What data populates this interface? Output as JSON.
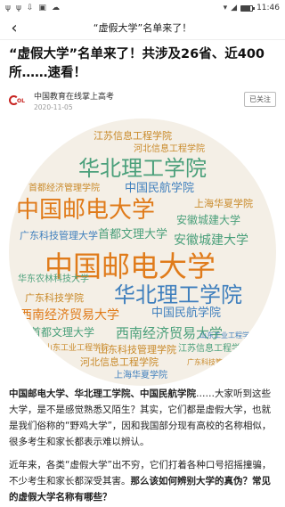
{
  "status": {
    "left_icons": [
      "cat-icon",
      "cat-icon",
      "download-icon",
      "image-icon",
      "cloud-icon"
    ],
    "left_glyphs": [
      "ψ",
      "ψ",
      "⇩",
      "▣",
      "☁"
    ],
    "time": "11:46"
  },
  "nav": {
    "title": "“虚假大学”名单来了！"
  },
  "article": {
    "headline": "“虚假大学”名单来了！共涉及26省、近400所……速看！",
    "author": "中国教育在线掌上高考",
    "date": "2020-11-05",
    "follow": "已关注",
    "logo_text": "OL"
  },
  "cloud": {
    "words": [
      {
        "t": "江苏信息工程学院",
        "c": "#c98a2a"
      },
      {
        "t": "河北信息工程学院",
        "c": "#c98a2a"
      },
      {
        "t": "华北理工学院",
        "c": "#4ba07b"
      },
      {
        "t": "首都经济管理学院",
        "c": "#c98a2a"
      },
      {
        "t": "中国民航学院",
        "c": "#3f7fbd"
      },
      {
        "t": "上海华夏学院",
        "c": "#c98a2a"
      },
      {
        "t": "中国邮电大学",
        "c": "#e07b1a"
      },
      {
        "t": "安徽城建大学",
        "c": "#4ba07b"
      },
      {
        "t": "首都文理大学",
        "c": "#4ba07b"
      },
      {
        "t": "广东科技管理大学",
        "c": "#3f7fbd"
      },
      {
        "t": "安徽城建大学",
        "c": "#4ba07b"
      },
      {
        "t": "中国邮电大学",
        "c": "#e07b1a"
      },
      {
        "t": "华东农林科技大学",
        "c": "#4ba07b"
      },
      {
        "t": "华北理工学院",
        "c": "#3f7fbd"
      },
      {
        "t": "广东科技学院",
        "c": "#c98a2a"
      },
      {
        "t": "西南经济贸易大学",
        "c": "#e07b1a"
      },
      {
        "t": "中国民航学院",
        "c": "#3f7fbd"
      },
      {
        "t": "首都文理大学",
        "c": "#4ba07b"
      },
      {
        "t": "西南经济贸易大学",
        "c": "#4ba07b"
      },
      {
        "t": "山东工业工程学院",
        "c": "#c98a2a"
      },
      {
        "t": "山东科技管理学院",
        "c": "#c98a2a"
      },
      {
        "t": "江苏信息工程学院",
        "c": "#4ba07b"
      },
      {
        "t": "河北信息工程学院",
        "c": "#c98a2a"
      },
      {
        "t": "上海华夏学院",
        "c": "#3f7fbd"
      },
      {
        "t": "广东科技管理大学",
        "c": "#c98a2a"
      },
      {
        "t": "山东工业工程学院",
        "c": "#3f7fbd"
      }
    ]
  },
  "body": {
    "p1_bold": "中国邮电大学、华北理工学院、中国民航学院",
    "p1_rest": "……大家听到这些大学，是不是感觉熟悉又陌生？其实，它们都是虚假大学，也就是我们俗称的“野鸡大学”，因和我国部分现有高校的名称相似，很多考生和家长都表示难以辨认。",
    "p2_rest": "近年来，各类“虚假大学”出不穷，它们打着各种口号招摇撞骗，不少考生和家长都深受其害。",
    "p2_bold": "那么该如何辨别大学的真伪？常见的虚假大学名称有哪些？"
  }
}
